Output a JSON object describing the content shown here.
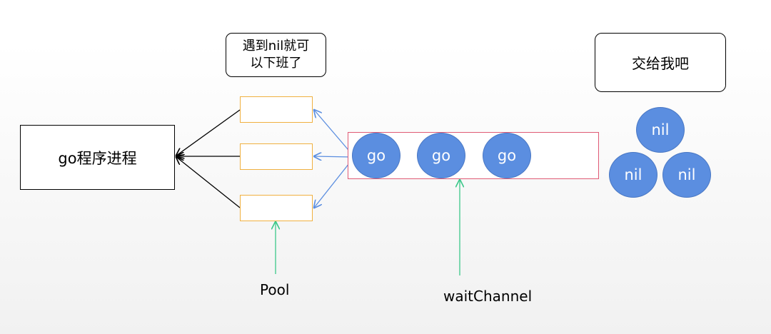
{
  "process": {
    "label": "go程序进程"
  },
  "bubble": {
    "line1": "遇到nil就可",
    "line2": "以下班了"
  },
  "give_box": {
    "label": "交给我吧"
  },
  "pool": {
    "label": "Pool",
    "slot_count": 3
  },
  "channel": {
    "label": "waitChannel",
    "items": [
      {
        "label": "go"
      },
      {
        "label": "go"
      },
      {
        "label": "go"
      }
    ]
  },
  "nils": [
    {
      "label": "nil"
    },
    {
      "label": "nil"
    },
    {
      "label": "nil"
    }
  ],
  "colors": {
    "circle_fill": "#5b8ee0",
    "slot_border": "#f0b040",
    "channel_border": "#e05a74",
    "blue_arrow": "#5b8ee0",
    "green_arrow": "#3cc88a",
    "black_arrow": "#000000"
  }
}
